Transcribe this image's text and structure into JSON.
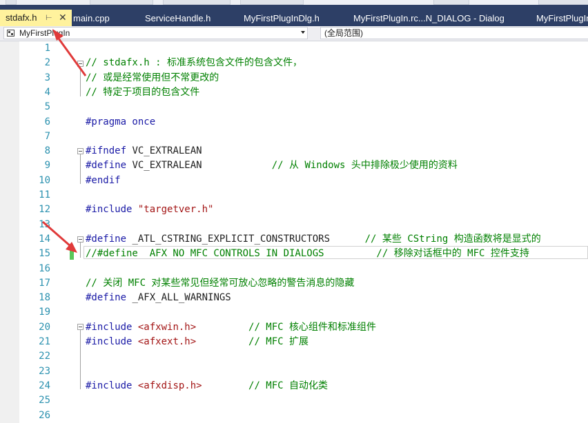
{
  "tabs": [
    {
      "label": "stdafx.h",
      "active": true
    },
    {
      "label": "main.cpp",
      "active": false
    },
    {
      "label": "ServiceHandle.h",
      "active": false
    },
    {
      "label": "MyFirstPlugInDlg.h",
      "active": false
    },
    {
      "label": "MyFirstPlugIn.rc...N_DIALOG - Dialog",
      "active": false
    },
    {
      "label": "MyFirstPlugIn",
      "active": false
    }
  ],
  "nav": {
    "project": "MyFirstPlugIn",
    "scope": "(全局范围)"
  },
  "code_lines": [
    {
      "n": "1",
      "tokens": []
    },
    {
      "n": "2",
      "tokens": [
        {
          "t": "// stdafx.h : 标准系统包含文件的包含文件，",
          "c": "comment"
        }
      ]
    },
    {
      "n": "3",
      "tokens": [
        {
          "t": "// 或是经常使用但不常更改的",
          "c": "comment"
        }
      ]
    },
    {
      "n": "4",
      "tokens": [
        {
          "t": "// 特定于项目的包含文件",
          "c": "comment"
        }
      ]
    },
    {
      "n": "5",
      "tokens": []
    },
    {
      "n": "6",
      "tokens": [
        {
          "t": "#pragma once",
          "c": "pp"
        }
      ]
    },
    {
      "n": "7",
      "tokens": []
    },
    {
      "n": "8",
      "tokens": [
        {
          "t": "#ifndef",
          "c": "pp"
        },
        {
          "t": " VC_EXTRALEAN",
          "c": "plain"
        }
      ]
    },
    {
      "n": "9",
      "tokens": [
        {
          "t": "#define",
          "c": "pp"
        },
        {
          "t": " VC_EXTRALEAN",
          "c": "plain"
        },
        {
          "t": "            // 从 Windows 头中排除极少使用的资料",
          "c": "comment"
        }
      ]
    },
    {
      "n": "10",
      "tokens": [
        {
          "t": "#endif",
          "c": "pp"
        }
      ]
    },
    {
      "n": "11",
      "tokens": []
    },
    {
      "n": "12",
      "tokens": [
        {
          "t": "#include",
          "c": "pp"
        },
        {
          "t": " \"targetver.h\"",
          "c": "str"
        }
      ]
    },
    {
      "n": "13",
      "tokens": []
    },
    {
      "n": "14",
      "tokens": [
        {
          "t": "#define",
          "c": "pp"
        },
        {
          "t": " _ATL_CSTRING_EXPLICIT_CONSTRUCTORS",
          "c": "plain"
        },
        {
          "t": "      // 某些 CString 构造函数将是显式的",
          "c": "comment"
        }
      ]
    },
    {
      "n": "15",
      "tokens": [
        {
          "t": "//#define _AFX_NO_MFC_CONTROLS_IN_DIALOGS         // 移除对话框中的 MFC 控件支持",
          "c": "comment"
        }
      ]
    },
    {
      "n": "16",
      "tokens": []
    },
    {
      "n": "17",
      "tokens": [
        {
          "t": "// 关闭 MFC 对某些常见但经常可放心忽略的警告消息的隐藏",
          "c": "comment"
        }
      ]
    },
    {
      "n": "18",
      "tokens": [
        {
          "t": "#define",
          "c": "pp"
        },
        {
          "t": " _AFX_ALL_WARNINGS",
          "c": "plain"
        }
      ]
    },
    {
      "n": "19",
      "tokens": []
    },
    {
      "n": "20",
      "tokens": [
        {
          "t": "#include",
          "c": "pp"
        },
        {
          "t": " <afxwin.h>",
          "c": "str"
        },
        {
          "t": "         // MFC 核心组件和标准组件",
          "c": "comment"
        }
      ]
    },
    {
      "n": "21",
      "tokens": [
        {
          "t": "#include",
          "c": "pp"
        },
        {
          "t": " <afxext.h>",
          "c": "str"
        },
        {
          "t": "         // MFC 扩展",
          "c": "comment"
        }
      ]
    },
    {
      "n": "22",
      "tokens": []
    },
    {
      "n": "23",
      "tokens": []
    },
    {
      "n": "24",
      "tokens": [
        {
          "t": "#include",
          "c": "pp"
        },
        {
          "t": " <afxdisp.h>",
          "c": "str"
        },
        {
          "t": "        // MFC 自动化类",
          "c": "comment"
        }
      ]
    },
    {
      "n": "25",
      "tokens": []
    },
    {
      "n": "26",
      "tokens": []
    }
  ],
  "colors": {
    "tab_bar": "#2d3f66",
    "active_tab": "#fff29d",
    "line_number": "#2b91af",
    "comment": "#008000",
    "preprocessor": "#1a1aa6",
    "string": "#a31515",
    "change_marker": "#58c75a",
    "annotation_arrow": "#e03a3a"
  }
}
